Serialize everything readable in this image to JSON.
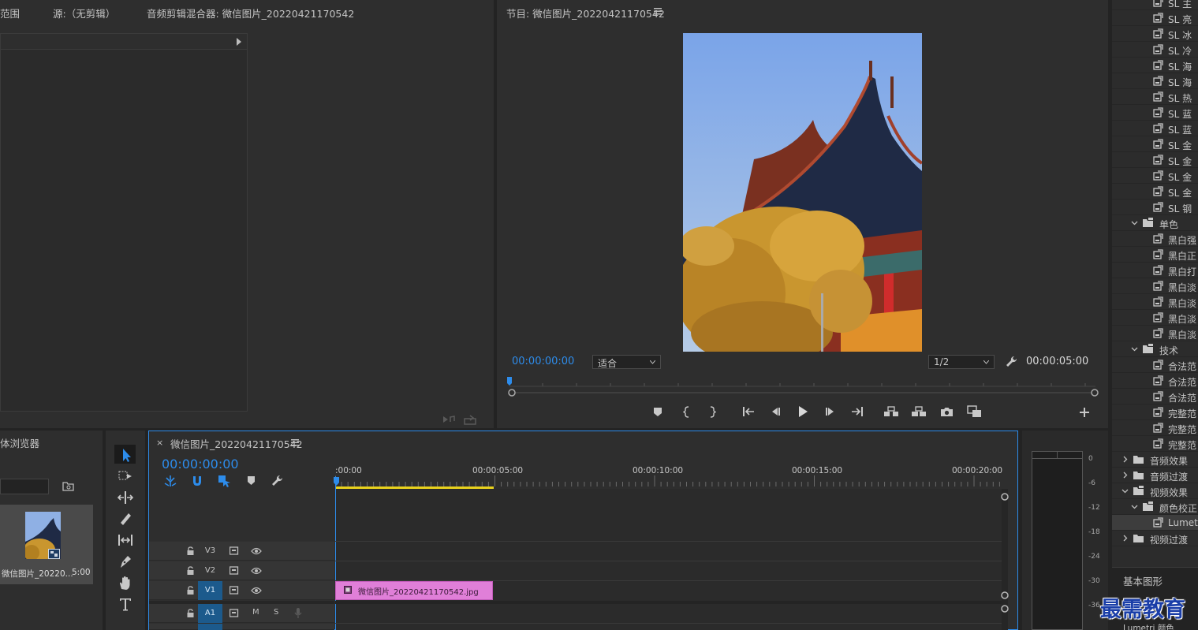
{
  "source_panel": {
    "tab_range_partial": "范围",
    "tab_source": "源:（无剪辑）",
    "tab_audio_mixer": "音频剪辑混合器: 微信图片_20220421170542"
  },
  "program_panel": {
    "title": "节目: 微信图片_20220421170542",
    "current_timecode": "00:00:00:00",
    "zoom_value": "适合",
    "resolution_value": "1/2",
    "duration_timecode": "00:00:05:00"
  },
  "effects_panel": {
    "items": [
      {
        "label": "SL 主",
        "kind": "preset",
        "indent": 2
      },
      {
        "label": "SL 亮",
        "kind": "preset",
        "indent": 2
      },
      {
        "label": "SL 冰",
        "kind": "preset",
        "indent": 2
      },
      {
        "label": "SL 冷",
        "kind": "preset",
        "indent": 2
      },
      {
        "label": "SL 海",
        "kind": "preset",
        "indent": 2
      },
      {
        "label": "SL 海",
        "kind": "preset",
        "indent": 2
      },
      {
        "label": "SL 热",
        "kind": "preset",
        "indent": 2
      },
      {
        "label": "SL 蓝",
        "kind": "preset",
        "indent": 2
      },
      {
        "label": "SL 蓝",
        "kind": "preset",
        "indent": 2
      },
      {
        "label": "SL 金",
        "kind": "preset",
        "indent": 2
      },
      {
        "label": "SL 金",
        "kind": "preset",
        "indent": 2
      },
      {
        "label": "SL 金",
        "kind": "preset",
        "indent": 2
      },
      {
        "label": "SL 金",
        "kind": "preset",
        "indent": 2
      },
      {
        "label": "SL 钢",
        "kind": "preset",
        "indent": 2
      },
      {
        "label": "单色",
        "kind": "folder-open",
        "indent": 1
      },
      {
        "label": "黑白强",
        "kind": "preset",
        "indent": 2
      },
      {
        "label": "黑白正",
        "kind": "preset",
        "indent": 2
      },
      {
        "label": "黑白打",
        "kind": "preset",
        "indent": 2
      },
      {
        "label": "黑白淡",
        "kind": "preset",
        "indent": 2
      },
      {
        "label": "黑白淡",
        "kind": "preset",
        "indent": 2
      },
      {
        "label": "黑白淡",
        "kind": "preset",
        "indent": 2
      },
      {
        "label": "黑白淡",
        "kind": "preset",
        "indent": 2
      },
      {
        "label": "技术",
        "kind": "folder-open",
        "indent": 1
      },
      {
        "label": "合法范",
        "kind": "preset",
        "indent": 2
      },
      {
        "label": "合法范",
        "kind": "preset",
        "indent": 2
      },
      {
        "label": "合法范",
        "kind": "preset",
        "indent": 2
      },
      {
        "label": "完整范",
        "kind": "preset",
        "indent": 2
      },
      {
        "label": "完整范",
        "kind": "preset",
        "indent": 2
      },
      {
        "label": "完整范",
        "kind": "preset",
        "indent": 2
      },
      {
        "label": "音频效果",
        "kind": "folder-closed",
        "indent": 0
      },
      {
        "label": "音频过渡",
        "kind": "folder-closed",
        "indent": 0
      },
      {
        "label": "视频效果",
        "kind": "folder-open",
        "indent": 0
      },
      {
        "label": "颜色校正",
        "kind": "folder-open",
        "indent": 1
      },
      {
        "label": "Lumetri",
        "kind": "preset-selected",
        "indent": 2
      },
      {
        "label": "视频过渡",
        "kind": "folder-closed",
        "indent": 0
      }
    ],
    "essential_graphics_label": "基本图形",
    "lumetri_color_label": "Lumetri 颜色"
  },
  "project_panel": {
    "tab_label_partial": "体浏览器",
    "clip_name": "微信图片_20220...",
    "clip_duration": "5:00"
  },
  "timeline": {
    "tab_title": "微信图片_20220421170542",
    "timecode": "00:00:00:00",
    "ruler_labels": [
      ":00:00",
      "00:00:05:00",
      "00:00:10:00",
      "00:00:15:00",
      "00:00:20:00"
    ],
    "tracks": [
      {
        "name": "V3",
        "targeted": false
      },
      {
        "name": "V2",
        "targeted": false
      },
      {
        "name": "V1",
        "targeted": true
      },
      {
        "name": "A1",
        "targeted": true
      }
    ],
    "audio_m": "M",
    "audio_s": "S",
    "clip": {
      "label": "微信图片_20220421170542.jpg",
      "color": "#e07fd8"
    }
  },
  "audio_meter": {
    "scale": [
      "0",
      "-6",
      "-12",
      "-18",
      "-24",
      "-30",
      "-36"
    ]
  },
  "watermark": "最需教育",
  "colors": {
    "accent_blue": "#2d8ceb",
    "clip_pink": "#e07fd8",
    "work_area_yellow": "#e8d11d",
    "watermark_blue": "#1a3ea8"
  }
}
